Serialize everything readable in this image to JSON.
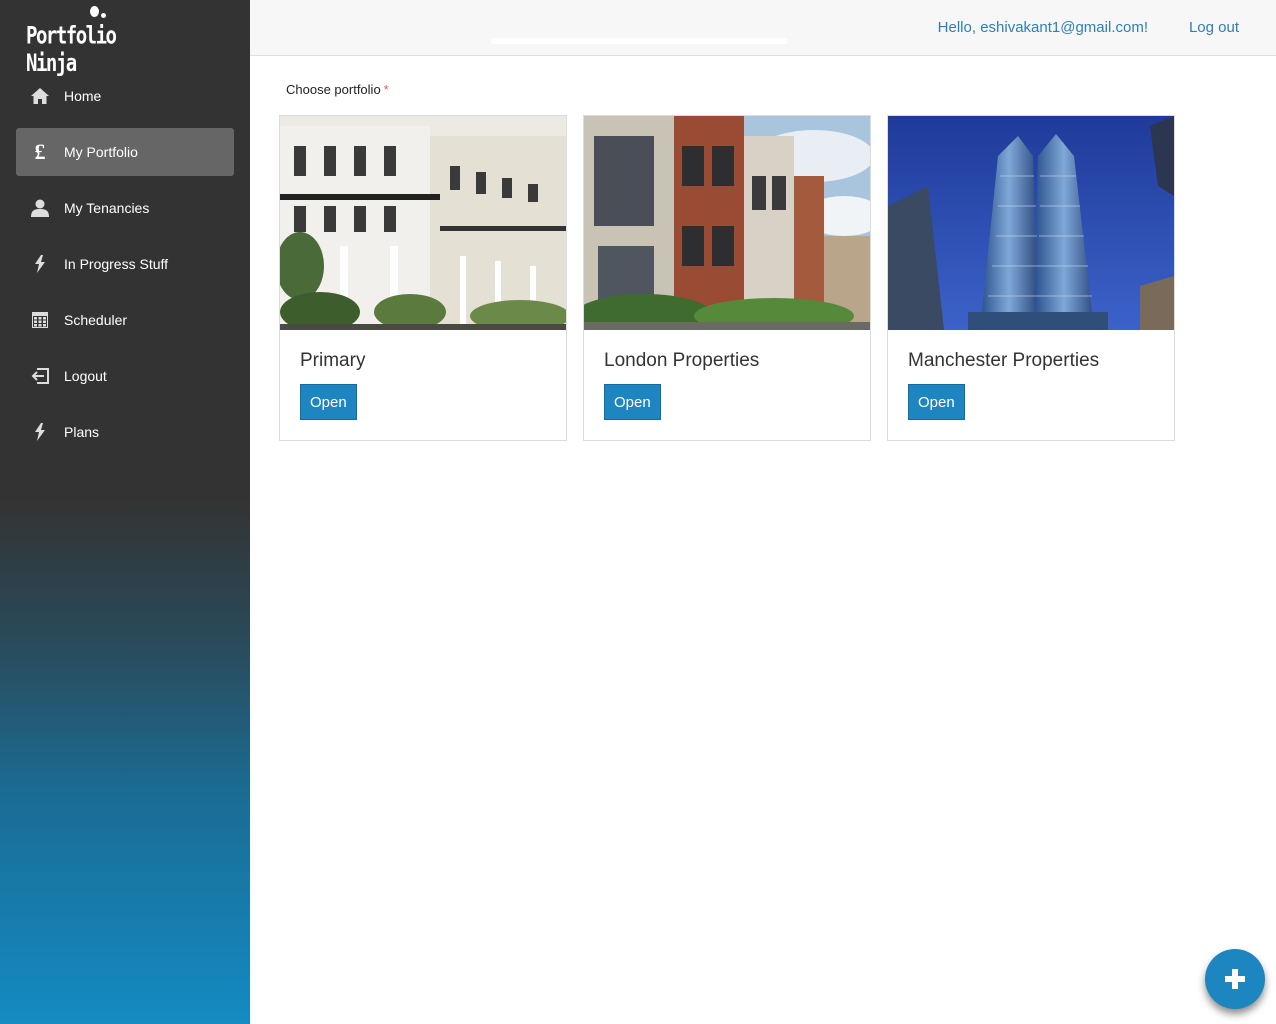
{
  "brand": {
    "name": "Portfolio Ninja",
    "logo_icon": "portfolio-ninja-logo"
  },
  "sidebar": {
    "items": [
      {
        "label": "Home",
        "icon": "home-icon",
        "active": false
      },
      {
        "label": "My Portfolio",
        "icon": "pound-icon",
        "active": true
      },
      {
        "label": "My Tenancies",
        "icon": "user-icon",
        "active": false
      },
      {
        "label": "In Progress Stuff",
        "icon": "lightning-icon",
        "active": false
      },
      {
        "label": "Scheduler",
        "icon": "calendar-icon",
        "active": false
      },
      {
        "label": "Logout",
        "icon": "logout-icon",
        "active": false
      },
      {
        "label": "Plans",
        "icon": "lightning-icon",
        "active": false
      }
    ]
  },
  "header": {
    "greeting": "Hello, eshivakant1@gmail.com!",
    "logout_label": "Log out"
  },
  "main": {
    "choose_label": "Choose portfolio",
    "required_marker": "*",
    "cards": [
      {
        "title": "Primary",
        "button_label": "Open",
        "image": "white-terraced-townhouses-photo"
      },
      {
        "title": "London Properties",
        "button_label": "Open",
        "image": "brick-townhouses-photo"
      },
      {
        "title": "Manchester Properties",
        "button_label": "Open",
        "image": "glass-skyscrapers-photo"
      }
    ],
    "fab_icon": "plus-icon"
  },
  "colors": {
    "accent": "#1d86c0",
    "link": "#2f7fb4",
    "sidebar_dark": "#333333",
    "sidebar_blue": "#148bc2",
    "active_item": "#666666"
  }
}
